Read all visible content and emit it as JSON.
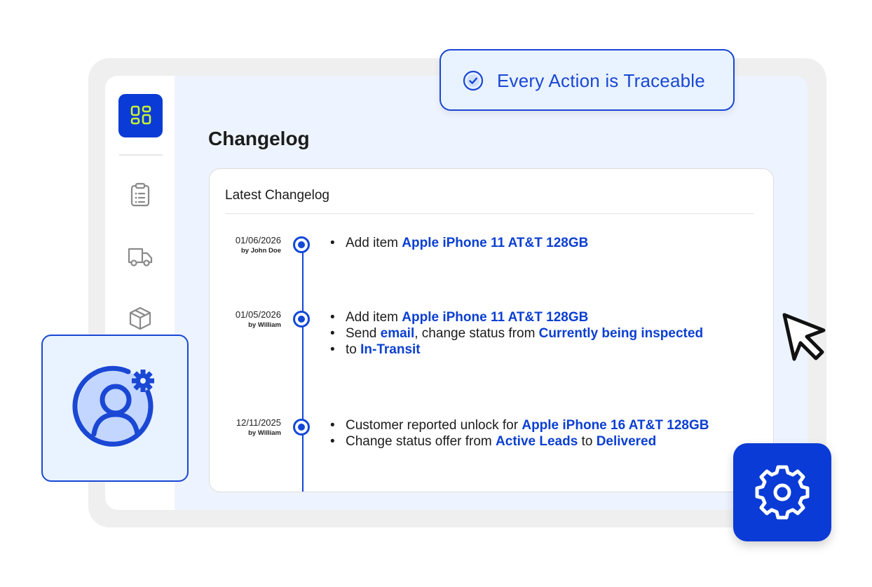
{
  "badge": {
    "text": "Every Action is Traceable",
    "icon": "check-circle-icon"
  },
  "sidebar": {
    "items": [
      {
        "icon": "dashboard-icon",
        "active": true
      },
      {
        "icon": "clipboard-list-icon"
      },
      {
        "icon": "truck-icon"
      },
      {
        "icon": "package-box-icon"
      }
    ]
  },
  "page": {
    "title": "Changelog"
  },
  "changelog": {
    "card_title": "Latest Changelog",
    "entries": [
      {
        "date": "01/06/2026",
        "by": "by John Doe",
        "lines": [
          {
            "parts": [
              "Add item ",
              "Apple iPhone 11 AT&T 128GB"
            ]
          }
        ]
      },
      {
        "date": "01/05/2026",
        "by": "by William",
        "lines": [
          {
            "parts": [
              "Add item ",
              "Apple iPhone 11 AT&T 128GB"
            ]
          },
          {
            "parts": [
              "Send ",
              "email",
              ", change status from ",
              "Currently being inspected"
            ]
          },
          {
            "parts": [
              "to ",
              "In-Transit"
            ]
          }
        ]
      },
      {
        "date": "12/11/2025",
        "by": "by William",
        "lines": [
          {
            "parts": [
              "Customer reported unlock for ",
              "Apple iPhone 16 AT&T 128GB"
            ]
          },
          {
            "parts": [
              "Change status offer from ",
              "Active Leads",
              " to ",
              "Delivered"
            ]
          }
        ]
      }
    ]
  },
  "colors": {
    "accent": "#0a3bd6",
    "link": "#0b3fd1",
    "logo_accent": "#c6f432",
    "badge_bg": "#e9f3ff"
  }
}
